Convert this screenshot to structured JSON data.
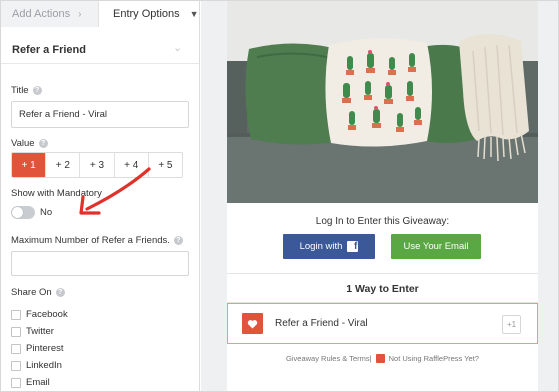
{
  "tabs": {
    "add_actions": "Add Actions",
    "add_actions_icon": "chevron-right-icon",
    "entry_options": "Entry Options",
    "entry_options_icon": "chevron-down-icon"
  },
  "section": {
    "title": "Refer a Friend",
    "toggle_icon": "chevron-down-icon"
  },
  "title_field": {
    "label": "Title",
    "value": "Refer a Friend - Viral"
  },
  "value_field": {
    "label": "Value",
    "options": [
      "+ 1",
      "+ 2",
      "+ 3",
      "+ 4",
      "+ 5"
    ],
    "selected": "+ 1"
  },
  "mandatory": {
    "label": "Show with Mandatory",
    "state_label": "No"
  },
  "max_refer": {
    "label": "Maximum Number of Refer a Friends.",
    "value": ""
  },
  "share_on": {
    "label": "Share On",
    "items": [
      "Facebook",
      "Twitter",
      "Pinterest",
      "LinkedIn",
      "Email"
    ]
  },
  "preview": {
    "login_title": "Log In to Enter this Giveaway:",
    "facebook_button": "Login with",
    "email_button": "Use Your Email",
    "ways_title": "1 Way to Enter",
    "entry_label": "Refer a Friend - Viral",
    "entry_points": "+1",
    "entry_icon": "heart-icon",
    "footer_rules": "Giveaway Rules & Terms",
    "footer_sep": "|",
    "footer_not_using": "Not Using RafflePress Yet?"
  },
  "colors": {
    "accent": "#e2533b",
    "facebook": "#3b5998",
    "email_green": "#5aa843",
    "annotation_arrow": "#e0322a"
  }
}
